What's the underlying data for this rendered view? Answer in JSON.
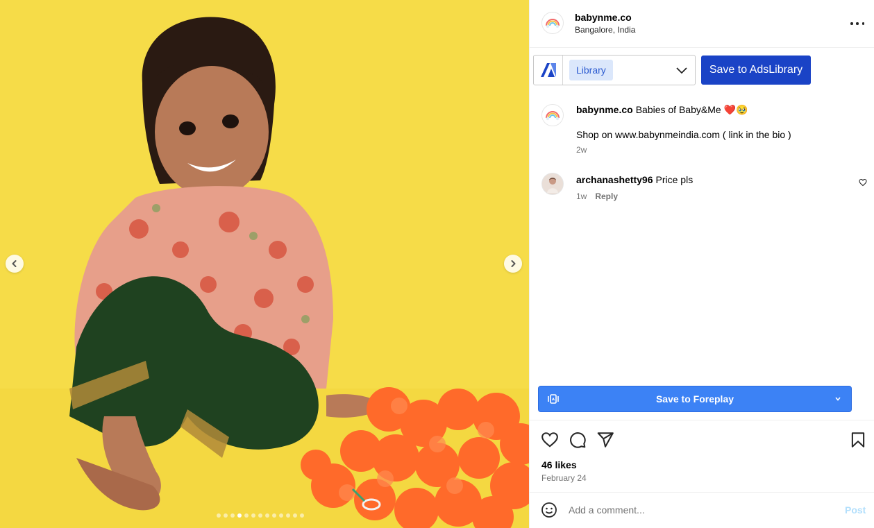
{
  "media": {
    "slide_count": 13,
    "active_slide": 4,
    "prev_icon": "chevron-left-icon",
    "next_icon": "chevron-right-icon"
  },
  "header": {
    "username": "babynme.co",
    "location": "Bangalore, India",
    "more_icon": "more-horizontal-icon"
  },
  "ads_library": {
    "selected_board": "Library",
    "save_label": "Save to AdsLibrary"
  },
  "caption": {
    "username": "babynme.co",
    "text": "Babies of Baby&Me ❤️🥹",
    "line2": "Shop on www.babynmeindia.com ( link in the bio )",
    "time": "2w"
  },
  "comments": [
    {
      "username": "archanashetty96",
      "text": "Price pls",
      "time": "1w",
      "reply_label": "Reply"
    }
  ],
  "foreplay": {
    "label": "Save to Foreplay"
  },
  "stats": {
    "likes": "46 likes",
    "date": "February 24"
  },
  "comment_box": {
    "placeholder": "Add a comment...",
    "post_label": "Post"
  },
  "colors": {
    "ads_button": "#1a43c6",
    "foreplay_button": "#3c82f5",
    "chip_bg": "#dbe7fb",
    "chip_text": "#2c5bd0",
    "post_disabled": "#b2dffc"
  }
}
